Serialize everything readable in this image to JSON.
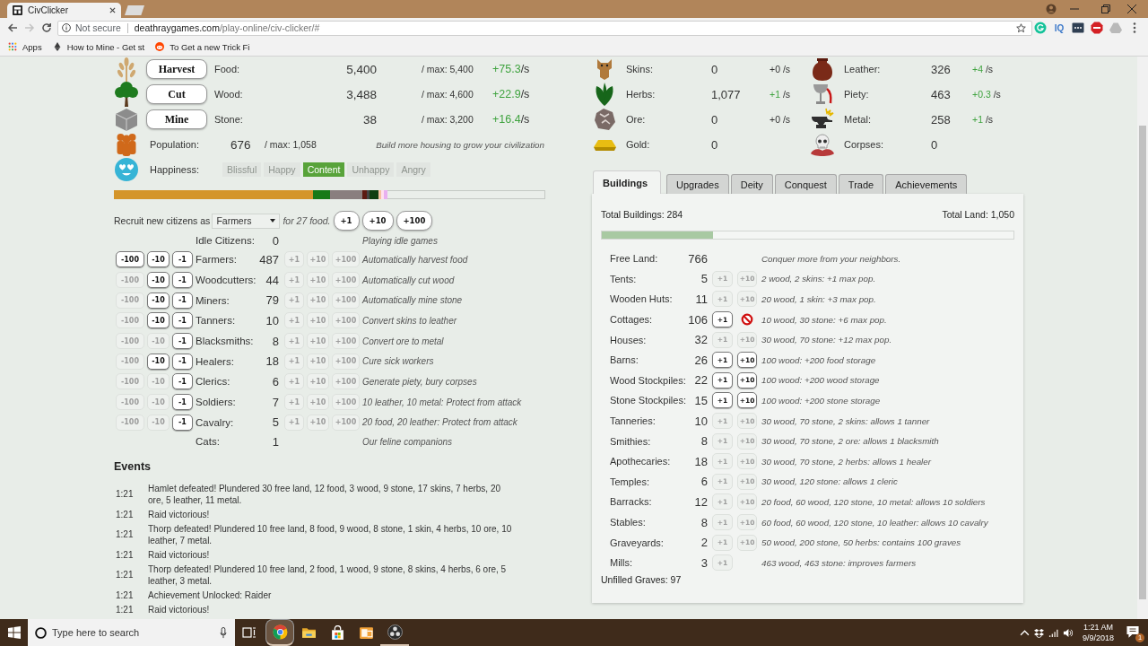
{
  "browser": {
    "tab_title": "CivClicker",
    "security": "Not secure",
    "domain": "deathraygames.com",
    "path": "/play-online/civ-clicker/#",
    "forward_enabled": false,
    "extension_label": "IQ",
    "bookmarks": [
      {
        "label": "Apps"
      },
      {
        "label": "How to Mine - Get st"
      },
      {
        "label": "To Get a new Trick Fi"
      }
    ]
  },
  "resources": [
    {
      "action": "Harvest",
      "name": "Food:",
      "amount": "5,400",
      "max": "/ max: 5,400",
      "rate": "+75.3",
      "unit": "/s",
      "gaining": true
    },
    {
      "action": "Cut",
      "name": "Wood:",
      "amount": "3,488",
      "max": "/ max: 4,600",
      "rate": "+22.9",
      "unit": "/s",
      "gaining": true
    },
    {
      "action": "Mine",
      "name": "Stone:",
      "amount": "38",
      "max": "/ max: 3,200",
      "rate": "+16.4",
      "unit": "/s",
      "gaining": true
    }
  ],
  "population": {
    "label": "Population:",
    "value": "676",
    "max": "/ max: 1,058",
    "note": "Build more housing to grow your civilization"
  },
  "happiness": {
    "label": "Happiness:",
    "levels": [
      {
        "label": "Blissful",
        "selected": false
      },
      {
        "label": "Happy",
        "selected": false
      },
      {
        "label": "Content",
        "selected": true
      },
      {
        "label": "Unhappy",
        "selected": false
      },
      {
        "label": "Angry",
        "selected": false
      }
    ]
  },
  "recruit": {
    "prefix": "Recruit new citizens as",
    "job": "Farmers",
    "suffix": "for 27 food.",
    "buttons": [
      "+1",
      "+10",
      "+100"
    ]
  },
  "jobs": [
    {
      "name": "Idle Citizens:",
      "count": "0",
      "note": "Playing idle games"
    },
    {
      "name": "Farmers:",
      "count": "487",
      "note": "Automatically harvest food",
      "minus": [
        {
          "label": "-100",
          "enabled": true
        },
        {
          "label": "-10",
          "enabled": true
        },
        {
          "label": "-1",
          "enabled": true
        }
      ],
      "plus": [
        {
          "label": "+1",
          "enabled": false
        },
        {
          "label": "+10",
          "enabled": false
        },
        {
          "label": "+100",
          "enabled": false
        }
      ]
    },
    {
      "name": "Woodcutters:",
      "count": "44",
      "note": "Automatically cut wood",
      "minus": [
        {
          "label": "-100",
          "enabled": false
        },
        {
          "label": "-10",
          "enabled": true
        },
        {
          "label": "-1",
          "enabled": true
        }
      ],
      "plus": [
        {
          "label": "+1",
          "enabled": false
        },
        {
          "label": "+10",
          "enabled": false
        },
        {
          "label": "+100",
          "enabled": false
        }
      ]
    },
    {
      "name": "Miners:",
      "count": "79",
      "note": "Automatically mine stone",
      "minus": [
        {
          "label": "-100",
          "enabled": false
        },
        {
          "label": "-10",
          "enabled": true
        },
        {
          "label": "-1",
          "enabled": true
        }
      ],
      "plus": [
        {
          "label": "+1",
          "enabled": false
        },
        {
          "label": "+10",
          "enabled": false
        },
        {
          "label": "+100",
          "enabled": false
        }
      ]
    },
    {
      "name": "Tanners:",
      "count": "10",
      "note": "Convert skins to leather",
      "minus": [
        {
          "label": "-100",
          "enabled": false
        },
        {
          "label": "-10",
          "enabled": true
        },
        {
          "label": "-1",
          "enabled": true
        }
      ],
      "plus": [
        {
          "label": "+1",
          "enabled": false
        },
        {
          "label": "+10",
          "enabled": false
        },
        {
          "label": "+100",
          "enabled": false
        }
      ]
    },
    {
      "name": "Blacksmiths:",
      "count": "8",
      "note": "Convert ore to metal",
      "minus": [
        {
          "label": "-100",
          "enabled": false
        },
        {
          "label": "-10",
          "enabled": false
        },
        {
          "label": "-1",
          "enabled": true
        }
      ],
      "plus": [
        {
          "label": "+1",
          "enabled": false
        },
        {
          "label": "+10",
          "enabled": false
        },
        {
          "label": "+100",
          "enabled": false
        }
      ]
    },
    {
      "name": "Healers:",
      "count": "18",
      "note": "Cure sick workers",
      "minus": [
        {
          "label": "-100",
          "enabled": false
        },
        {
          "label": "-10",
          "enabled": true
        },
        {
          "label": "-1",
          "enabled": true
        }
      ],
      "plus": [
        {
          "label": "+1",
          "enabled": false
        },
        {
          "label": "+10",
          "enabled": false
        },
        {
          "label": "+100",
          "enabled": false
        }
      ]
    },
    {
      "name": "Clerics:",
      "count": "6",
      "note": "Generate piety, bury corpses",
      "minus": [
        {
          "label": "-100",
          "enabled": false
        },
        {
          "label": "-10",
          "enabled": false
        },
        {
          "label": "-1",
          "enabled": true
        }
      ],
      "plus": [
        {
          "label": "+1",
          "enabled": false
        },
        {
          "label": "+10",
          "enabled": false
        },
        {
          "label": "+100",
          "enabled": false
        }
      ]
    },
    {
      "name": "Soldiers:",
      "count": "7",
      "note": "10 leather, 10 metal: Protect from attack",
      "minus": [
        {
          "label": "-100",
          "enabled": false
        },
        {
          "label": "-10",
          "enabled": false
        },
        {
          "label": "-1",
          "enabled": true
        }
      ],
      "plus": [
        {
          "label": "+1",
          "enabled": false
        },
        {
          "label": "+10",
          "enabled": false
        },
        {
          "label": "+100",
          "enabled": false
        }
      ]
    },
    {
      "name": "Cavalry:",
      "count": "5",
      "note": "20 food, 20 leather: Protect from attack",
      "minus": [
        {
          "label": "-100",
          "enabled": false
        },
        {
          "label": "-10",
          "enabled": false
        },
        {
          "label": "-1",
          "enabled": true
        }
      ],
      "plus": [
        {
          "label": "+1",
          "enabled": false
        },
        {
          "label": "+10",
          "enabled": false
        },
        {
          "label": "+100",
          "enabled": false
        }
      ]
    },
    {
      "name": "Cats:",
      "count": "1",
      "note": "Our feline companions"
    }
  ],
  "events": {
    "title": "Events",
    "items": [
      {
        "time": "1:21",
        "text": "Hamlet defeated! Plundered 30 free land, 12 food, 3 wood, 9 stone, 17 skins, 7 herbs, 20 ore, 5 leather, 11 metal."
      },
      {
        "time": "1:21",
        "text": "Raid victorious!"
      },
      {
        "time": "1:21",
        "text": "Thorp defeated! Plundered 10 free land, 8 food, 9 wood, 8 stone, 1 skin, 4 herbs, 10 ore, 10 leather, 7 metal."
      },
      {
        "time": "1:21",
        "text": "Raid victorious!"
      },
      {
        "time": "1:21",
        "text": "Thorp defeated! Plundered 10 free land, 2 food, 1 wood, 9 stone, 8 skins, 4 herbs, 6 ore, 5 leather, 3 metal."
      },
      {
        "time": "1:21",
        "text": "Achievement Unlocked: Raider"
      },
      {
        "time": "1:21",
        "text": "Raid victorious!"
      }
    ]
  },
  "side_resources": [
    {
      "name": "Skins:",
      "amount": "0",
      "rate": "+0",
      "unit": "/s",
      "gaining": false
    },
    {
      "name": "Leather:",
      "amount": "326",
      "rate": "+4",
      "unit": "/s",
      "gaining": true
    },
    {
      "name": "Herbs:",
      "amount": "1,077",
      "rate": "+1",
      "unit": "/s",
      "gaining": true
    },
    {
      "name": "Piety:",
      "amount": "463",
      "rate": "+0.3",
      "unit": "/s",
      "gaining": true
    },
    {
      "name": "Ore:",
      "amount": "0",
      "rate": "+0",
      "unit": "/s",
      "gaining": false
    },
    {
      "name": "Metal:",
      "amount": "258",
      "rate": "+1",
      "unit": "/s",
      "gaining": true
    },
    {
      "name": "Gold:",
      "amount": "0"
    },
    {
      "name": "Corpses:",
      "amount": "0"
    }
  ],
  "tabs": [
    {
      "label": "Buildings",
      "selected": true
    },
    {
      "label": "Upgrades",
      "selected": false
    },
    {
      "label": "Deity",
      "selected": false
    },
    {
      "label": "Conquest",
      "selected": false
    },
    {
      "label": "Trade",
      "selected": false
    },
    {
      "label": "Achievements",
      "selected": false
    }
  ],
  "buildings": {
    "total_buildings": "Total Buildings: 284",
    "total_land": "Total Land: 1,050",
    "level": 0.27,
    "rows": [
      {
        "name": "Free Land:",
        "count": "766",
        "note": "Conquer more from your neighbors."
      },
      {
        "name": "Tents:",
        "count": "5",
        "note": "2 wood, 2 skins: +1 max pop.",
        "buttons": [
          {
            "kind": "button",
            "label": "+1",
            "enabled": false
          },
          {
            "kind": "button",
            "label": "+10",
            "enabled": false
          }
        ]
      },
      {
        "name": "Wooden Huts:",
        "count": "11",
        "note": "20 wood, 1 skin: +3 max pop.",
        "buttons": [
          {
            "kind": "button",
            "label": "+1",
            "enabled": false
          },
          {
            "kind": "button",
            "label": "+10",
            "enabled": false
          }
        ]
      },
      {
        "name": "Cottages:",
        "count": "106",
        "note": "10 wood, 30 stone: +6 max pop.",
        "buttons": [
          {
            "kind": "button",
            "label": "+1",
            "enabled": true
          },
          {
            "kind": "cursor"
          }
        ]
      },
      {
        "name": "Houses:",
        "count": "32",
        "note": "30 wood, 70 stone: +12 max pop.",
        "buttons": [
          {
            "kind": "button",
            "label": "+1",
            "enabled": false
          },
          {
            "kind": "button",
            "label": "+10",
            "enabled": false
          }
        ]
      },
      {
        "name": "Barns:",
        "count": "26",
        "note": "100 wood: +200 food storage",
        "buttons": [
          {
            "kind": "button",
            "label": "+1",
            "enabled": true
          },
          {
            "kind": "button",
            "label": "+10",
            "enabled": true
          }
        ]
      },
      {
        "name": "Wood Stockpiles:",
        "count": "22",
        "note": "100 wood: +200 wood storage",
        "buttons": [
          {
            "kind": "button",
            "label": "+1",
            "enabled": true
          },
          {
            "kind": "button",
            "label": "+10",
            "enabled": true
          }
        ]
      },
      {
        "name": "Stone Stockpiles:",
        "count": "15",
        "note": "100 wood: +200 stone storage",
        "buttons": [
          {
            "kind": "button",
            "label": "+1",
            "enabled": true
          },
          {
            "kind": "button",
            "label": "+10",
            "enabled": true
          }
        ]
      },
      {
        "name": "Tanneries:",
        "count": "10",
        "note": "30 wood, 70 stone, 2 skins: allows 1 tanner",
        "buttons": [
          {
            "kind": "button",
            "label": "+1",
            "enabled": false
          },
          {
            "kind": "button",
            "label": "+10",
            "enabled": false
          }
        ]
      },
      {
        "name": "Smithies:",
        "count": "8",
        "note": "30 wood, 70 stone, 2 ore: allows 1 blacksmith",
        "buttons": [
          {
            "kind": "button",
            "label": "+1",
            "enabled": false
          },
          {
            "kind": "button",
            "label": "+10",
            "enabled": false
          }
        ]
      },
      {
        "name": "Apothecaries:",
        "count": "18",
        "note": "30 wood, 70 stone, 2 herbs: allows 1 healer",
        "buttons": [
          {
            "kind": "button",
            "label": "+1",
            "enabled": false
          },
          {
            "kind": "button",
            "label": "+10",
            "enabled": false
          }
        ]
      },
      {
        "name": "Temples:",
        "count": "6",
        "note": "30 wood, 120 stone: allows 1 cleric",
        "buttons": [
          {
            "kind": "button",
            "label": "+1",
            "enabled": false
          },
          {
            "kind": "button",
            "label": "+10",
            "enabled": false
          }
        ]
      },
      {
        "name": "Barracks:",
        "count": "12",
        "note": "20 food, 60 wood, 120 stone, 10 metal: allows 10 soldiers",
        "buttons": [
          {
            "kind": "button",
            "label": "+1",
            "enabled": false
          },
          {
            "kind": "button",
            "label": "+10",
            "enabled": false
          }
        ]
      },
      {
        "name": "Stables:",
        "count": "8",
        "note": "60 food, 60 wood, 120 stone, 10 leather: allows 10 cavalry",
        "buttons": [
          {
            "kind": "button",
            "label": "+1",
            "enabled": false
          },
          {
            "kind": "button",
            "label": "+10",
            "enabled": false
          }
        ]
      },
      {
        "name": "Graveyards:",
        "count": "2",
        "note": "50 wood, 200 stone, 50 herbs: contains 100 graves",
        "buttons": [
          {
            "kind": "button",
            "label": "+1",
            "enabled": false
          },
          {
            "kind": "button",
            "label": "+10",
            "enabled": false
          }
        ]
      },
      {
        "name": "Mills:",
        "count": "3",
        "note": "463 wood, 463 stone: improves farmers",
        "buttons": [
          {
            "kind": "button",
            "label": "+1",
            "enabled": false
          }
        ]
      }
    ],
    "footer": "Unfilled Graves: 97"
  },
  "taskbar": {
    "search_placeholder": "Type here to search",
    "apps": [
      {
        "selected": true,
        "running": true
      },
      {
        "selected": false,
        "running": false
      },
      {
        "selected": false,
        "running": false
      },
      {
        "selected": false,
        "running": false
      },
      {
        "selected": false,
        "running": true
      }
    ],
    "time": "1:21 AM",
    "date": "9/9/2018",
    "notifications": "1"
  }
}
